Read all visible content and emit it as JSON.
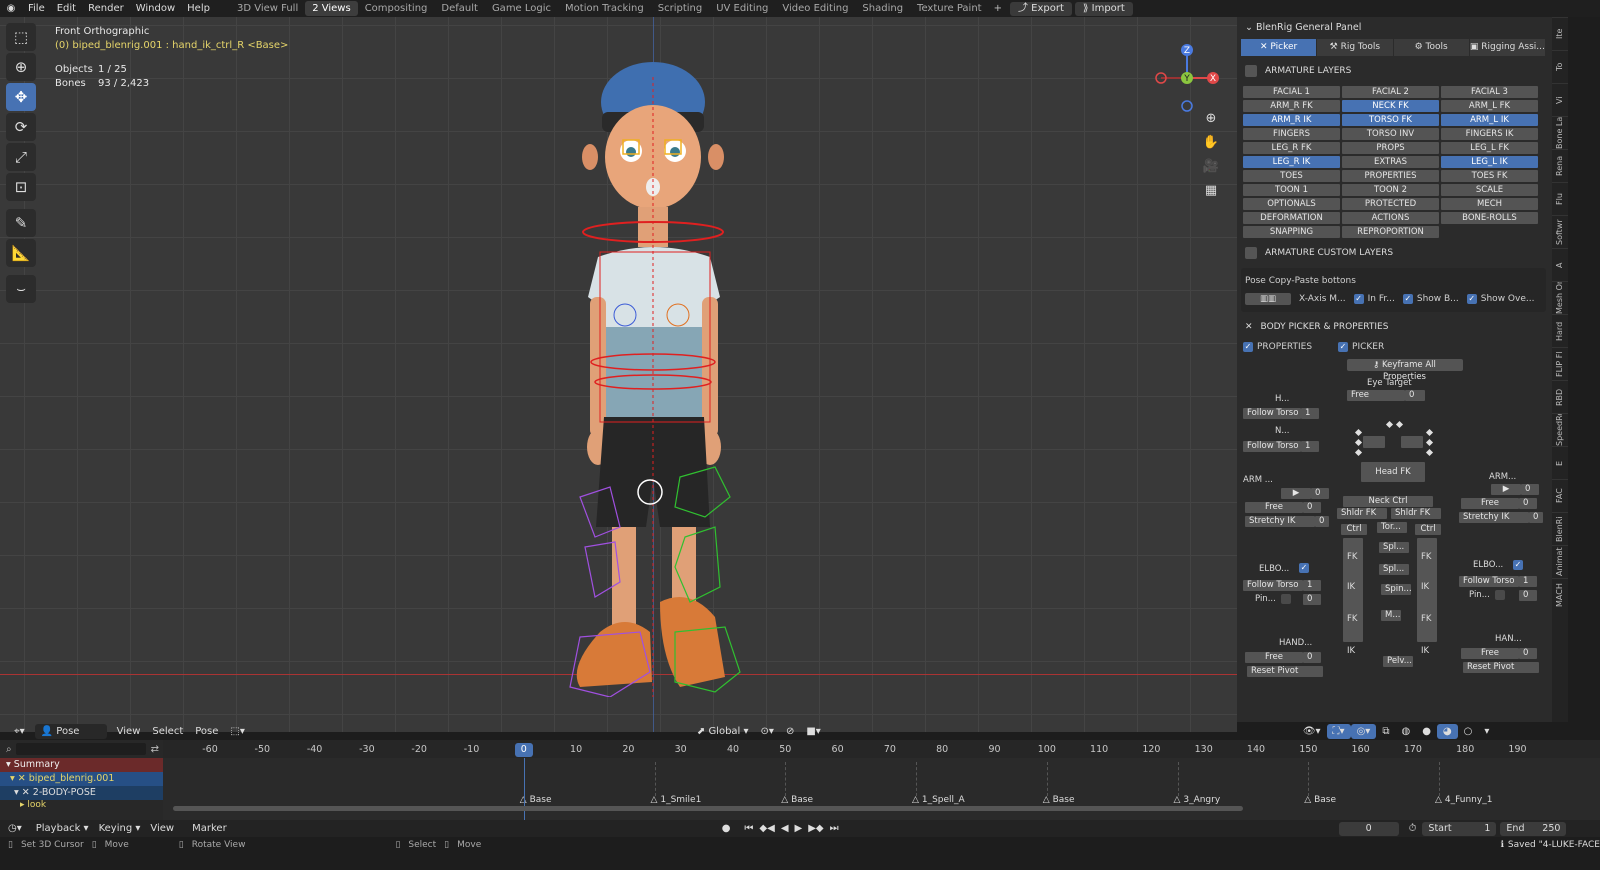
{
  "menus": [
    "File",
    "Edit",
    "Render",
    "Window",
    "Help"
  ],
  "workspaces": [
    "3D View Full",
    "2 Views",
    "Compositing",
    "Default",
    "Game Logic",
    "Motion Tracking",
    "Scripting",
    "UV Editing",
    "Video Editing",
    "Shading",
    "Texture Paint"
  ],
  "active_workspace": "2 Views",
  "export_label": "Export",
  "import_label": "Import",
  "viewport": {
    "view_name": "Front Orthographic",
    "active_object": "(0) biped_blenrig.001 : hand_ik_ctrl_R <Base>",
    "objects_label": "Objects",
    "objects_value": "1 / 25",
    "bones_label": "Bones",
    "bones_value": "93 / 2,423",
    "gizmo": {
      "z": "Z",
      "y": "Y",
      "x": "X"
    }
  },
  "viewport_header": {
    "mode": "Pose Mode",
    "menus": [
      "View",
      "Select",
      "Pose"
    ],
    "transform_orientation": "Global"
  },
  "npanel": {
    "title": "BlenRig General Panel",
    "tabs": [
      "Picker",
      "Rig Tools",
      "Tools",
      "Rigging Assi..."
    ],
    "armature_layers_title": "ARMATURE LAYERS",
    "layers": [
      {
        "label": "FACIAL 1",
        "on": false
      },
      {
        "label": "FACIAL 2",
        "on": false
      },
      {
        "label": "FACIAL 3",
        "on": false
      },
      {
        "label": "ARM_R FK",
        "on": false
      },
      {
        "label": "NECK FK",
        "on": true
      },
      {
        "label": "ARM_L FK",
        "on": false
      },
      {
        "label": "ARM_R IK",
        "on": true
      },
      {
        "label": "TORSO FK",
        "on": true
      },
      {
        "label": "ARM_L IK",
        "on": true
      },
      {
        "label": "FINGERS",
        "on": false
      },
      {
        "label": "TORSO INV",
        "on": false
      },
      {
        "label": "FINGERS IK",
        "on": false
      },
      {
        "label": "LEG_R FK",
        "on": false
      },
      {
        "label": "PROPS",
        "on": false
      },
      {
        "label": "LEG_L FK",
        "on": false
      },
      {
        "label": "LEG_R IK",
        "on": true
      },
      {
        "label": "EXTRAS",
        "on": false
      },
      {
        "label": "LEG_L IK",
        "on": true
      },
      {
        "label": "TOES",
        "on": false
      },
      {
        "label": "PROPERTIES",
        "on": false
      },
      {
        "label": "TOES FK",
        "on": false
      },
      {
        "label": "TOON 1",
        "on": false
      },
      {
        "label": "TOON 2",
        "on": false
      },
      {
        "label": "SCALE",
        "on": false
      },
      {
        "label": "OPTIONALS",
        "on": false
      },
      {
        "label": "PROTECTED",
        "on": false
      },
      {
        "label": "MECH",
        "on": false
      },
      {
        "label": "DEFORMATION",
        "on": false
      },
      {
        "label": "ACTIONS",
        "on": false
      },
      {
        "label": "BONE-ROLLS",
        "on": false
      },
      {
        "label": "SNAPPING",
        "on": false
      },
      {
        "label": "REPROPORTION",
        "on": false
      }
    ],
    "custom_layers_title": "ARMATURE CUSTOM LAYERS",
    "copy_paste_title": "Pose Copy-Paste bottons",
    "copy_paste_opts": [
      "X-Axis M...",
      "In Fr...",
      "Show B...",
      "Show Ove..."
    ],
    "body_picker_title": "BODY PICKER & PROPERTIES",
    "properties_label": "PROPERTIES",
    "picker_label": "PICKER",
    "keyframe_all": "Keyframe All Properties",
    "picker": {
      "eye_target": "Eye Target",
      "free": "Free",
      "zero": "0",
      "one": "1",
      "h_label": "H...",
      "n_label": "N...",
      "follow_torso": "Follow Torso",
      "head_fk": "Head FK",
      "neck_ctrl": "Neck Ctrl",
      "arm_label": "ARM ...",
      "arm_r_label": "ARM...",
      "shldr_fk": "Shldr FK",
      "stretchy_ik": "Stretchy IK",
      "ctrl": "Ctrl",
      "tor": "Tor...",
      "spi": "Spl...",
      "spin": "Spin...",
      "fk": "FK",
      "ik": "IK",
      "m": "M...",
      "pelv": "Pelv...",
      "elbo": "ELBO...",
      "pin": "Pin...",
      "hand": "HAND...",
      "han": "HAN...",
      "reset_pivot": "Reset Pivot"
    }
  },
  "right_tabs": [
    "Ite",
    "To",
    "Vi",
    "Bone La",
    "Rena",
    "Flu",
    "Softwr",
    "A",
    "Mesh On",
    "Hard",
    "FLIP Fl",
    "RBD",
    "SpeedRe",
    "E",
    "FAC",
    "BlenRi",
    "Animat",
    "MACH"
  ],
  "timeline": {
    "channels": {
      "summary": "Summary",
      "rig": "biped_blenrig.001",
      "group": "2-BODY-POSE",
      "look": "look"
    },
    "ticks": [
      -60,
      -50,
      -40,
      -30,
      -20,
      -10,
      0,
      10,
      20,
      30,
      40,
      50,
      60,
      70,
      80,
      90,
      100,
      110,
      120,
      130,
      140,
      150,
      160,
      170,
      180,
      190
    ],
    "current_frame": "0",
    "markers": [
      "Base",
      "1_Smile1",
      "Base",
      "1_Spell_A",
      "Base",
      "3_Angry",
      "Base",
      "4_Funny_1"
    ]
  },
  "playback": {
    "menus": [
      "Playback",
      "Keying",
      "View",
      "Marker"
    ],
    "frame": "0",
    "start_label": "Start",
    "start": "1",
    "end_label": "End",
    "end": "250"
  },
  "status": {
    "items": [
      "Set 3D Cursor",
      "Move",
      "Rotate View",
      "Select",
      "Move"
    ],
    "saved": "Saved \"4-LUKE-FACE"
  }
}
